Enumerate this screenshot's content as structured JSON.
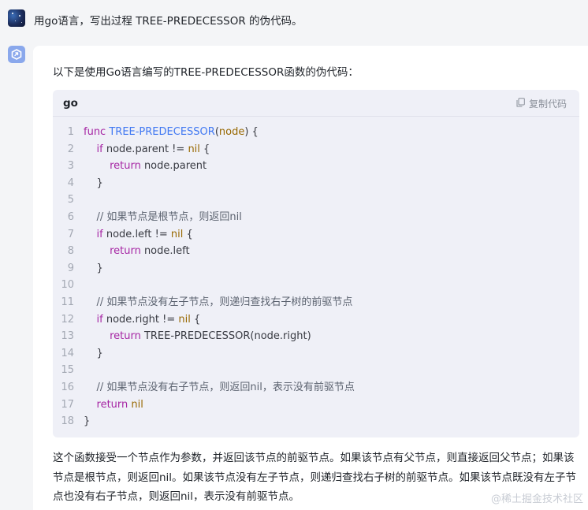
{
  "user_prompt": {
    "text": "用go语言，写出过程 TREE-PREDECESSOR 的伪代码。"
  },
  "answer": {
    "intro": "以下是使用Go语言编写的TREE-PREDECESSOR函数的伪代码：",
    "code_block": {
      "language": "go",
      "copy_label": "复制代码",
      "lines": [
        {
          "n": "1",
          "tokens": [
            {
              "t": "kw",
              "v": "func "
            },
            {
              "t": "fn",
              "v": "TREE-PREDECESSOR"
            },
            {
              "t": "p",
              "v": "("
            },
            {
              "t": "param",
              "v": "node"
            },
            {
              "t": "p",
              "v": ") {"
            }
          ]
        },
        {
          "n": "2",
          "tokens": [
            {
              "t": "p",
              "v": "    "
            },
            {
              "t": "kw",
              "v": "if"
            },
            {
              "t": "p",
              "v": " node.parent != "
            },
            {
              "t": "lit",
              "v": "nil"
            },
            {
              "t": "p",
              "v": " {"
            }
          ]
        },
        {
          "n": "3",
          "tokens": [
            {
              "t": "p",
              "v": "        "
            },
            {
              "t": "kw",
              "v": "return"
            },
            {
              "t": "p",
              "v": " node.parent"
            }
          ]
        },
        {
          "n": "4",
          "tokens": [
            {
              "t": "p",
              "v": "    }"
            }
          ]
        },
        {
          "n": "5",
          "tokens": []
        },
        {
          "n": "6",
          "tokens": [
            {
              "t": "p",
              "v": "    "
            },
            {
              "t": "cmt",
              "v": "// 如果节点是根节点，则返回nil"
            }
          ]
        },
        {
          "n": "7",
          "tokens": [
            {
              "t": "p",
              "v": "    "
            },
            {
              "t": "kw",
              "v": "if"
            },
            {
              "t": "p",
              "v": " node.left != "
            },
            {
              "t": "lit",
              "v": "nil"
            },
            {
              "t": "p",
              "v": " {"
            }
          ]
        },
        {
          "n": "8",
          "tokens": [
            {
              "t": "p",
              "v": "        "
            },
            {
              "t": "kw",
              "v": "return"
            },
            {
              "t": "p",
              "v": " node.left"
            }
          ]
        },
        {
          "n": "9",
          "tokens": [
            {
              "t": "p",
              "v": "    }"
            }
          ]
        },
        {
          "n": "10",
          "tokens": []
        },
        {
          "n": "11",
          "tokens": [
            {
              "t": "p",
              "v": "    "
            },
            {
              "t": "cmt",
              "v": "// 如果节点没有左子节点，则递归查找右子树的前驱节点"
            }
          ]
        },
        {
          "n": "12",
          "tokens": [
            {
              "t": "p",
              "v": "    "
            },
            {
              "t": "kw",
              "v": "if"
            },
            {
              "t": "p",
              "v": " node.right != "
            },
            {
              "t": "lit",
              "v": "nil"
            },
            {
              "t": "p",
              "v": " {"
            }
          ]
        },
        {
          "n": "13",
          "tokens": [
            {
              "t": "p",
              "v": "        "
            },
            {
              "t": "kw",
              "v": "return"
            },
            {
              "t": "p",
              "v": " TREE-PREDECESSOR(node.right)"
            }
          ]
        },
        {
          "n": "14",
          "tokens": [
            {
              "t": "p",
              "v": "    }"
            }
          ]
        },
        {
          "n": "15",
          "tokens": []
        },
        {
          "n": "16",
          "tokens": [
            {
              "t": "p",
              "v": "    "
            },
            {
              "t": "cmt",
              "v": "// 如果节点没有右子节点，则返回nil，表示没有前驱节点"
            }
          ]
        },
        {
          "n": "17",
          "tokens": [
            {
              "t": "p",
              "v": "    "
            },
            {
              "t": "kw",
              "v": "return"
            },
            {
              "t": "p",
              "v": " "
            },
            {
              "t": "lit",
              "v": "nil"
            }
          ]
        },
        {
          "n": "18",
          "tokens": [
            {
              "t": "p",
              "v": "}"
            }
          ]
        }
      ]
    },
    "outro": "这个函数接受一个节点作为参数，并返回该节点的前驱节点。如果该节点有父节点，则直接返回父节点；如果该节点是根节点，则返回nil。如果该节点没有左子节点，则递归查找右子树的前驱节点。如果该节点既没有左子节点也没有右子节点，则返回nil，表示没有前驱节点。"
  },
  "watermark": "@稀土掘金技术社区",
  "icons": {
    "user_avatar": "user-avatar-image",
    "bot_avatar": "assistant-logo-icon",
    "copy": "copy-icon"
  },
  "colors": {
    "keyword": "#a626a4",
    "function": "#4078f2",
    "literal": "#986801",
    "comment": "#5c6370",
    "line_number": "#a3a8b3",
    "code_bg": "#eff0f7",
    "page_bg": "#f4f5f7",
    "accent": "#8aa8ec"
  }
}
